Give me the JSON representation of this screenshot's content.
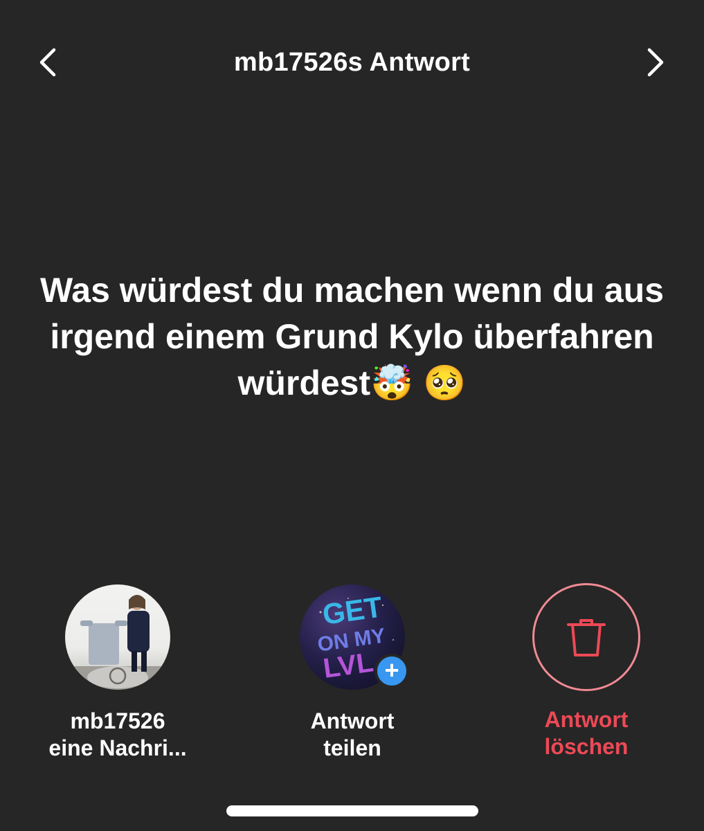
{
  "header": {
    "title": "mb17526s Antwort",
    "back_icon": "chevron-left-icon",
    "forward_icon": "chevron-right-icon"
  },
  "question": {
    "text": "Was würdest du machen wenn du aus irgend einem Grund Kylo überfahren würdest🤯 🥺"
  },
  "actions": [
    {
      "id": "message",
      "line1": "mb17526",
      "line2": "eine Nachri...",
      "icon": "profile-avatar"
    },
    {
      "id": "share",
      "line1": "Antwort",
      "line2": "teilen",
      "icon": "story-avatar",
      "avatar_text": [
        "GET",
        "ON MY",
        "LVL"
      ],
      "badge": "+"
    },
    {
      "id": "delete",
      "line1": "Antwort",
      "line2": "löschen",
      "icon": "trash-icon"
    }
  ],
  "colors": {
    "background": "#262626",
    "text": "#ffffff",
    "danger": "#ed4956",
    "danger_ring": "#f08a94",
    "badge": "#3897f0"
  }
}
